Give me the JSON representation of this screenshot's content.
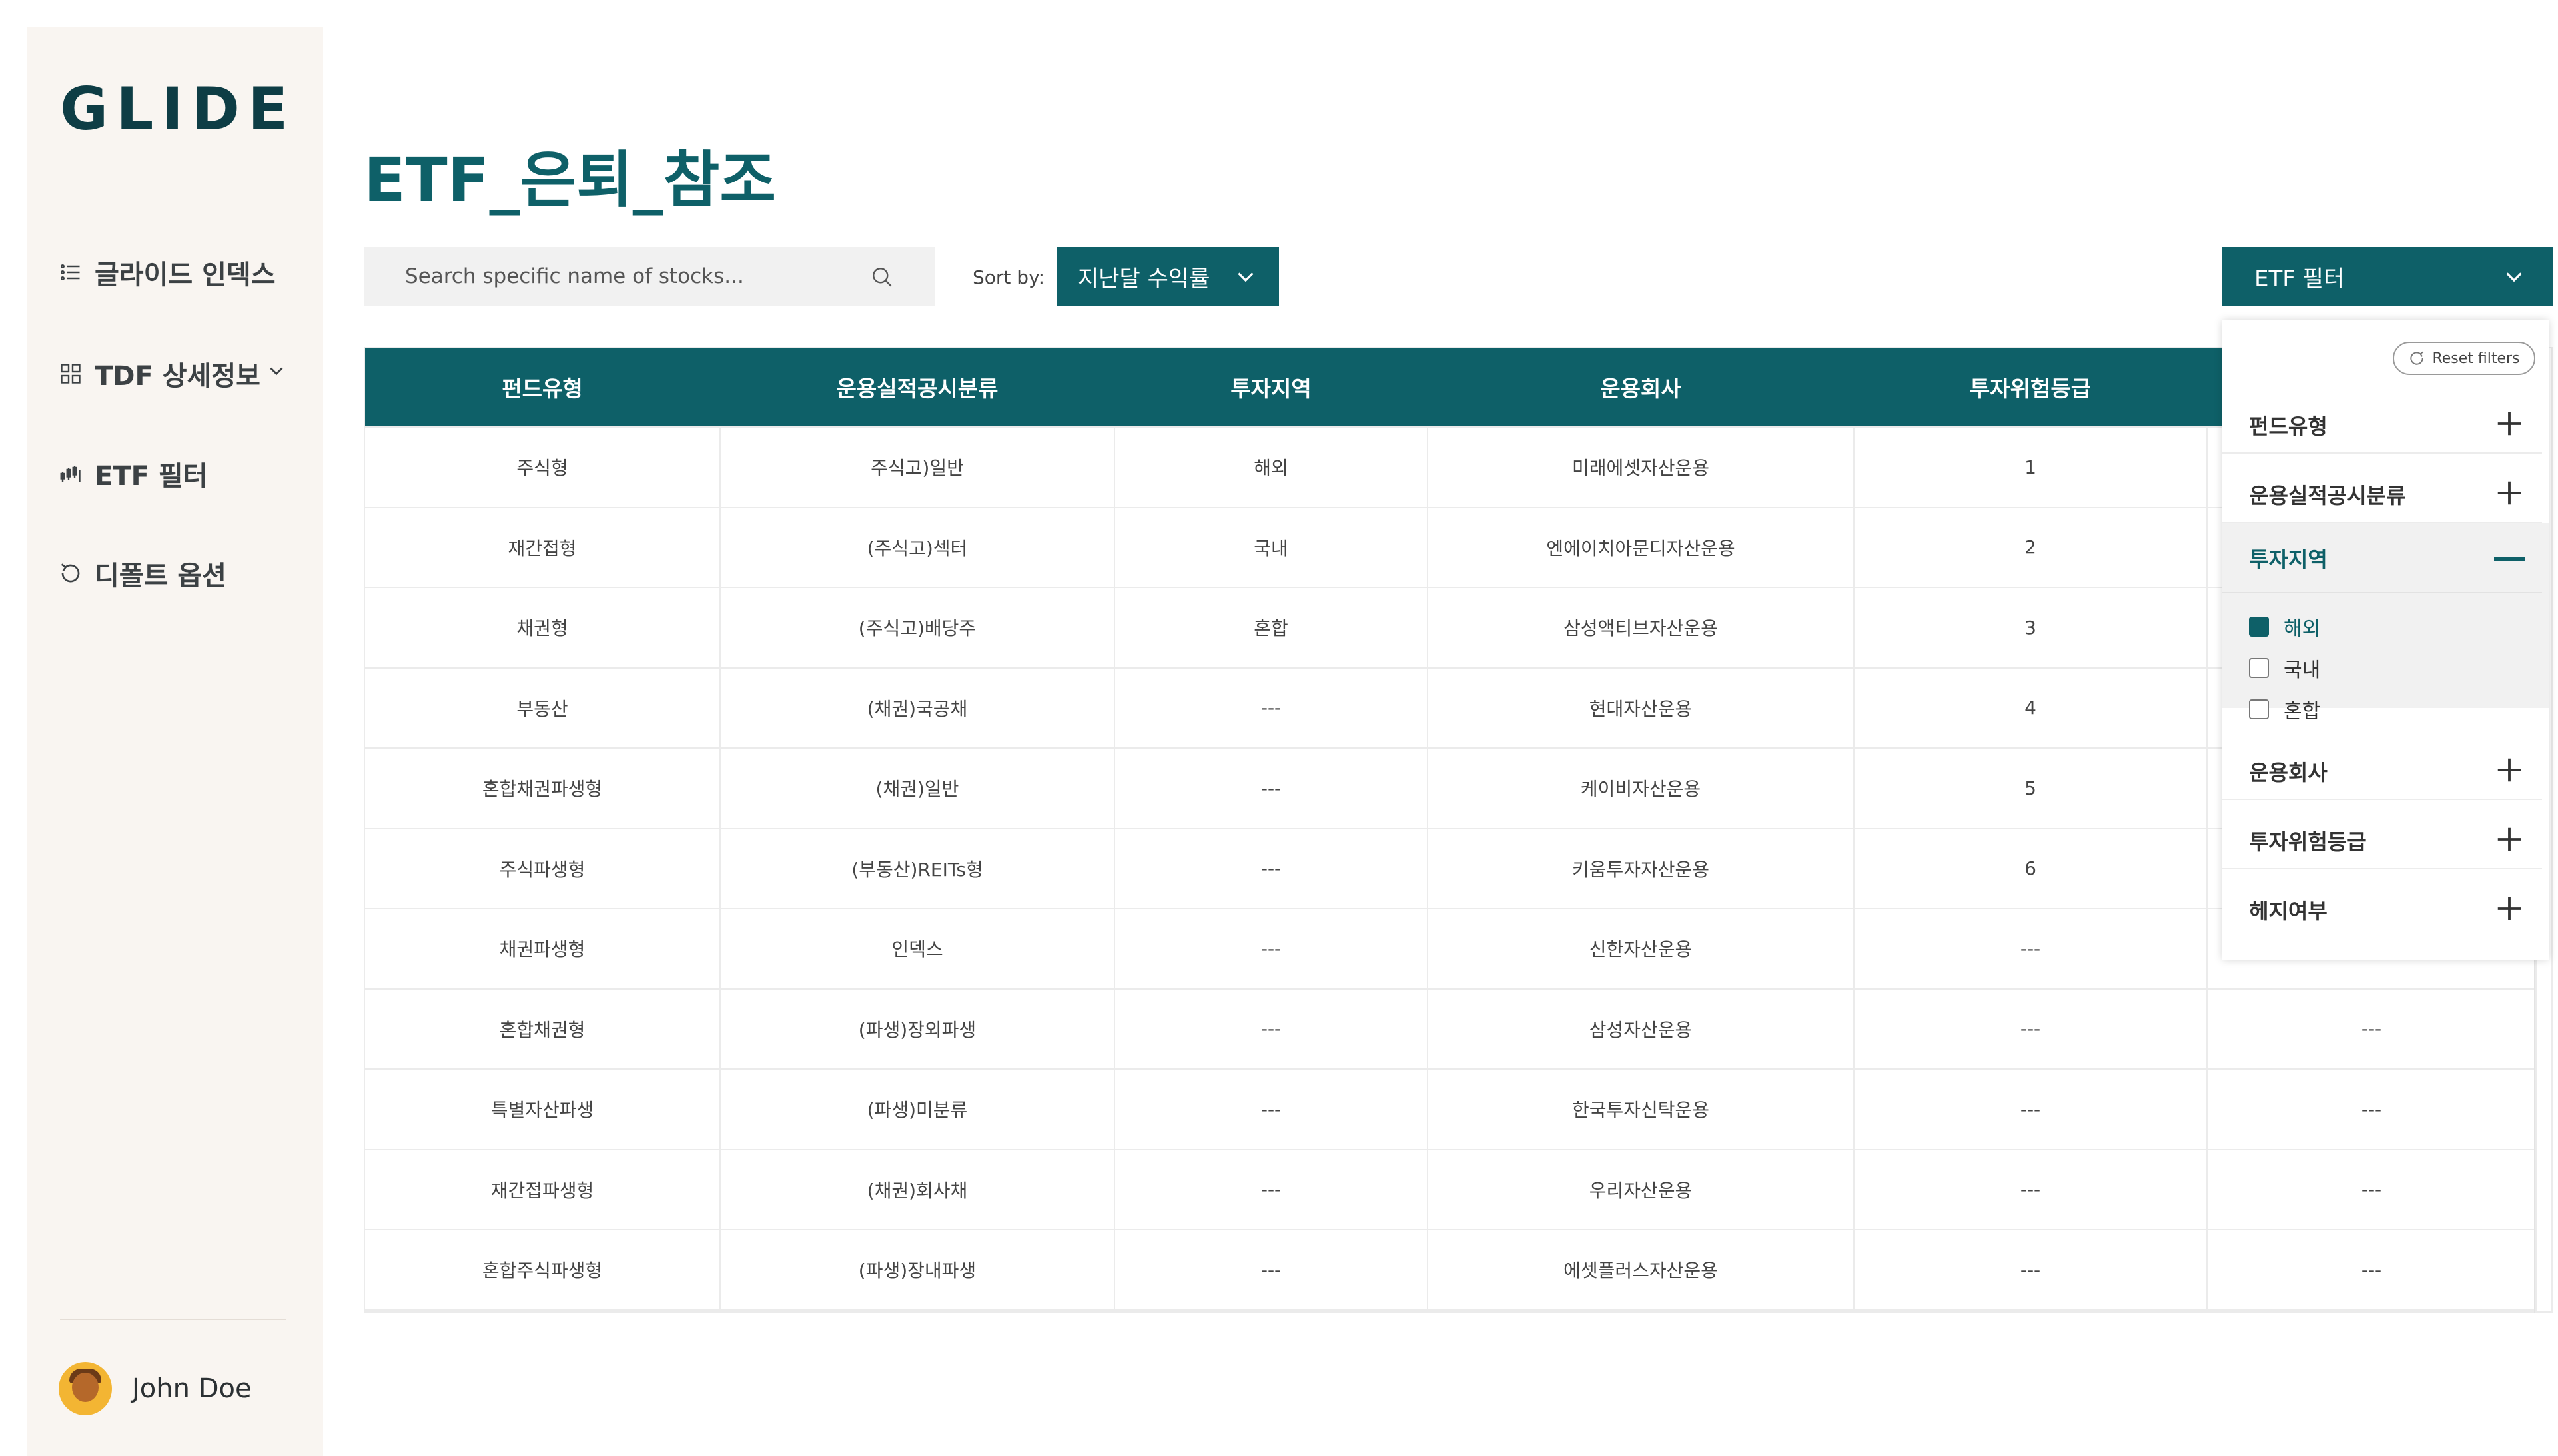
{
  "sidebar": {
    "logo": "GLIDE",
    "items": [
      {
        "label": "글라이드 인덱스",
        "icon": "list-icon"
      },
      {
        "label": "TDF 상세정보",
        "icon": "grid-icon"
      },
      {
        "label": "ETF 필터",
        "icon": "chart-icon"
      },
      {
        "label": "디폴트 옵션",
        "icon": "refresh-icon"
      }
    ],
    "user": {
      "name": "John Doe"
    }
  },
  "page": {
    "title": "ETF_은퇴_참조"
  },
  "search": {
    "placeholder": "Search specific name of stocks..."
  },
  "sort": {
    "label": "Sort by:",
    "value": "지난달 수익률"
  },
  "filter_button": {
    "label": "ETF 필터"
  },
  "table": {
    "columns": [
      "펀드유형",
      "운용실적공시분류",
      "투자지역",
      "운용회사",
      "투자위험등급",
      ""
    ],
    "rows": [
      [
        "주식형",
        "주식고)일반",
        "해외",
        "미래에셋자산운용",
        "1",
        ""
      ],
      [
        "재간접형",
        "(주식고)섹터",
        "국내",
        "엔에이치아문디자산운용",
        "2",
        ""
      ],
      [
        "채권형",
        "(주식고)배당주",
        "혼합",
        "삼성액티브자산운용",
        "3",
        ""
      ],
      [
        "부동산",
        "(채권)국공채",
        "---",
        "현대자산운용",
        "4",
        ""
      ],
      [
        "혼합채권파생형",
        "(채권)일반",
        "---",
        "케이비자산운용",
        "5",
        ""
      ],
      [
        "주식파생형",
        "(부동산)REITs형",
        "---",
        "키움투자자산운용",
        "6",
        ""
      ],
      [
        "채권파생형",
        "인덱스",
        "---",
        "신한자산운용",
        "---",
        ""
      ],
      [
        "혼합채권형",
        "(파생)장외파생",
        "---",
        "삼성자산운용",
        "---",
        "---"
      ],
      [
        "특별자산파생",
        "(파생)미분류",
        "---",
        "한국투자신탁운용",
        "---",
        "---"
      ],
      [
        "재간접파생형",
        "(채권)회사채",
        "---",
        "우리자산운용",
        "---",
        "---"
      ],
      [
        "혼합주식파생형",
        "(파생)장내파생",
        "---",
        "에셋플러스자산운용",
        "---",
        "---"
      ]
    ]
  },
  "filter_panel": {
    "reset_label": "Reset filters",
    "sections": [
      {
        "label": "펀드유형"
      },
      {
        "label": "운용실적공시분류"
      },
      {
        "label": "투자지역",
        "expanded": true,
        "options": [
          {
            "label": "해외",
            "checked": true
          },
          {
            "label": "국내",
            "checked": false
          },
          {
            "label": "혼합",
            "checked": false
          }
        ]
      },
      {
        "label": "운용회사"
      },
      {
        "label": "투자위험등급"
      },
      {
        "label": "헤지여부"
      }
    ]
  },
  "colors": {
    "accent": "#0e6068",
    "sidebar_bg": "#f9f5f1",
    "header_bg": "#0e6068"
  }
}
